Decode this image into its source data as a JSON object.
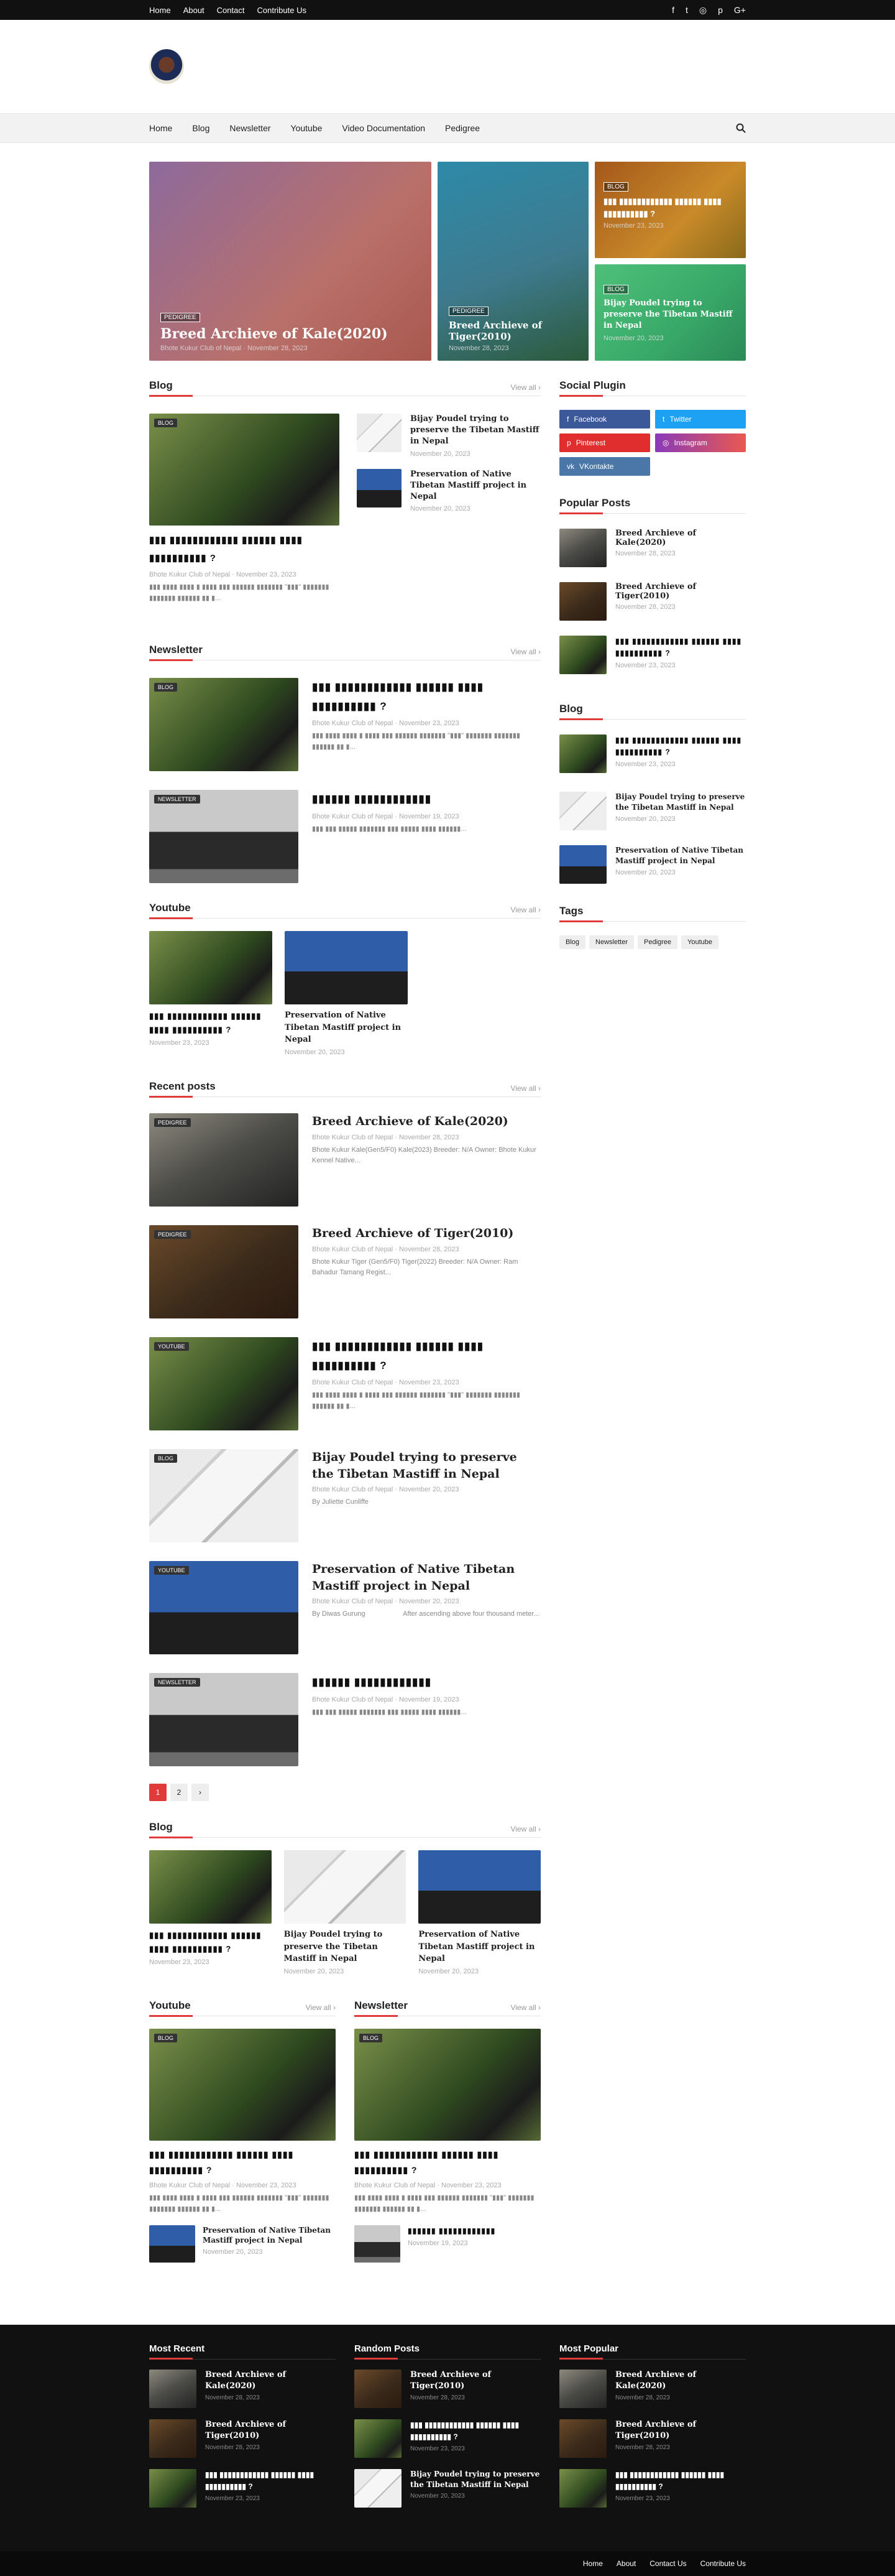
{
  "topbar": {
    "links": [
      "Home",
      "About",
      "Contact",
      "Contribute Us"
    ],
    "social": [
      "f",
      "t",
      "◎",
      "p",
      "G+"
    ]
  },
  "nav": {
    "items": [
      "Home",
      "Blog",
      "Newsletter",
      "Youtube",
      "Video Documentation",
      "Pedigree"
    ]
  },
  "featured": [
    {
      "tag": "PEDIGREE",
      "title": "Breed Archieve of Kale(2020)",
      "author": "Bhote Kukur Club of Nepal",
      "date": "November 28, 2023"
    },
    {
      "tag": "PEDIGREE",
      "title": "Breed Archieve of Tiger(2010)",
      "date": "November 28, 2023"
    },
    {
      "tag": "BLOG",
      "title": "▮▮▮ ▮▮▮▮▮▮▮▮▮▮▮▮ ▮▮▮▮▮▮ ▮▮▮▮ ▮▮▮▮▮▮▮▮▮▮ ?",
      "date": "November 23, 2023"
    },
    {
      "tag": "BLOG",
      "title": "Bijay Poudel trying to preserve the Tibetan Mastiff in Nepal",
      "date": "November 20, 2023"
    }
  ],
  "blog": {
    "title": "Blog",
    "view_all": "View all ›",
    "main": {
      "tag": "BLOG",
      "title": "▮▮▮ ▮▮▮▮▮▮▮▮▮▮▮▮ ▮▮▮▮▮▮ ▮▮▮▮ ▮▮▮▮▮▮▮▮▮▮ ?",
      "author": "Bhote Kukur Club of Nepal",
      "date": "November 23, 2023",
      "excerpt": "▮▮▮ ▮▮▮▮ ▮▮▮▮ ▮ ▮▮▮▮ ▮▮▮ ▮▮▮▮▮▮ ▮▮▮▮▮▮▮ \"▮▮▮\" ▮▮▮▮▮▮▮ ▮▮▮▮▮▮▮ ▮▮▮▮▮▮ ▮▮ ▮..."
    },
    "side": [
      {
        "title": "Bijay Poudel trying to preserve the Tibetan Mastiff in Nepal",
        "date": "November 20, 2023"
      },
      {
        "title": "Preservation of Native Tibetan Mastiff project in Nepal",
        "date": "November 20, 2023"
      }
    ]
  },
  "newsletter": {
    "title": "Newsletter",
    "view_all": "View all ›",
    "items": [
      {
        "tag": "BLOG",
        "title": "▮▮▮ ▮▮▮▮▮▮▮▮▮▮▮▮ ▮▮▮▮▮▮ ▮▮▮▮ ▮▮▮▮▮▮▮▮▮▮ ?",
        "author": "Bhote Kukur Club of Nepal",
        "date": "November 23, 2023",
        "excerpt": "▮▮▮ ▮▮▮▮ ▮▮▮▮ ▮ ▮▮▮▮ ▮▮▮ ▮▮▮▮▮▮ ▮▮▮▮▮▮▮ \"▮▮▮\" ▮▮▮▮▮▮▮ ▮▮▮▮▮▮▮ ▮▮▮▮▮▮ ▮▮ ▮..."
      },
      {
        "tag": "NEWSLETTER",
        "title": "▮▮▮▮▮▮ ▮▮▮▮▮▮▮▮▮▮▮▮",
        "author": "Bhote Kukur Club of Nepal",
        "date": "November 19, 2023",
        "excerpt": "▮▮▮ ▮▮▮ ▮▮▮▮▮ ▮▮▮▮▮▮▮ ▮▮▮ ▮▮▮▮▮ ▮▮▮▮ ▮▮▮▮▮▮..."
      }
    ]
  },
  "youtube": {
    "title": "Youtube",
    "view_all": "View all ›",
    "items": [
      {
        "title": "▮▮▮ ▮▮▮▮▮▮▮▮▮▮▮▮ ▮▮▮▮▮▮ ▮▮▮▮ ▮▮▮▮▮▮▮▮▮▮ ?",
        "date": "November 23, 2023"
      },
      {
        "title": "Preservation of Native Tibetan Mastiff project in Nepal",
        "date": "November 20, 2023"
      }
    ]
  },
  "recent": {
    "title": "Recent posts",
    "view_all": "View all ›",
    "items": [
      {
        "tag": "PEDIGREE",
        "title": "Breed Archieve of Kale(2020)",
        "author": "Bhote Kukur Club of Nepal",
        "date": "November 28, 2023",
        "excerpt": "Bhote Kukur Kale(Gen5/F0) Kale(2023) Breeder: N/A Owner: Bhote Kukur Kennel Native..."
      },
      {
        "tag": "PEDIGREE",
        "title": "Breed Archieve of Tiger(2010)",
        "author": "Bhote Kukur Club of Nepal",
        "date": "November 28, 2023",
        "excerpt": "Bhote Kukur Tiger (Gen5/F0) Tiger(2022) Breeder: N/A Owner: Ram Bahadur Tamang Regist..."
      },
      {
        "tag": "YOUTUBE",
        "title": "▮▮▮ ▮▮▮▮▮▮▮▮▮▮▮▮ ▮▮▮▮▮▮ ▮▮▮▮ ▮▮▮▮▮▮▮▮▮▮ ?",
        "author": "Bhote Kukur Club of Nepal",
        "date": "November 23, 2023",
        "excerpt": "▮▮▮ ▮▮▮▮ ▮▮▮▮ ▮ ▮▮▮▮ ▮▮▮ ▮▮▮▮▮▮ ▮▮▮▮▮▮▮ \"▮▮▮\" ▮▮▮▮▮▮▮ ▮▮▮▮▮▮▮ ▮▮▮▮▮▮ ▮▮ ▮..."
      },
      {
        "tag": "BLOG",
        "title": "Bijay Poudel trying to preserve the Tibetan Mastiff in Nepal",
        "author": "Bhote Kukur Club of Nepal",
        "date": "November 20, 2023",
        "excerpt": "By Juliette Cunliffe"
      },
      {
        "tag": "YOUTUBE",
        "title": "Preservation of Native Tibetan Mastiff project in Nepal",
        "author": "Bhote Kukur Club of Nepal",
        "date": "November 20, 2023",
        "excerpt": "By Diwas Gurung                    After ascending above four thousand meter..."
      },
      {
        "tag": "NEWSLETTER",
        "title": "▮▮▮▮▮▮ ▮▮▮▮▮▮▮▮▮▮▮▮",
        "author": "Bhote Kukur Club of Nepal",
        "date": "November 19, 2023",
        "excerpt": "▮▮▮ ▮▮▮ ▮▮▮▮▮ ▮▮▮▮▮▮▮ ▮▮▮ ▮▮▮▮▮ ▮▮▮▮ ▮▮▮▮▮▮..."
      }
    ]
  },
  "pagination": [
    "1",
    "2",
    "›"
  ],
  "blog2": {
    "title": "Blog",
    "view_all": "View all ›",
    "items": [
      {
        "title": "▮▮▮ ▮▮▮▮▮▮▮▮▮▮▮▮ ▮▮▮▮▮▮ ▮▮▮▮ ▮▮▮▮▮▮▮▮▮▮ ?",
        "date": "November 23, 2023"
      },
      {
        "title": "Bijay Poudel trying to preserve the Tibetan Mastiff in Nepal",
        "date": "November 20, 2023"
      },
      {
        "title": "Preservation of Native Tibetan Mastiff project in Nepal",
        "date": "November 20, 2023"
      }
    ]
  },
  "youtube2": {
    "title": "Youtube",
    "view_all": "View all ›",
    "main": {
      "tag": "BLOG",
      "title": "▮▮▮ ▮▮▮▮▮▮▮▮▮▮▮▮ ▮▮▮▮▮▮ ▮▮▮▮ ▮▮▮▮▮▮▮▮▮▮ ?",
      "author": "Bhote Kukur Club of Nepal",
      "date": "November 23, 2023",
      "excerpt": "▮▮▮ ▮▮▮▮ ▮▮▮▮ ▮ ▮▮▮▮ ▮▮▮ ▮▮▮▮▮▮ ▮▮▮▮▮▮▮ \"▮▮▮\" ▮▮▮▮▮▮▮ ▮▮▮▮▮▮▮ ▮▮▮▮▮▮ ▮▮ ▮..."
    },
    "small": {
      "title": "Preservation of Native Tibetan Mastiff project in Nepal",
      "date": "November 20, 2023"
    }
  },
  "newsletter2": {
    "title": "Newsletter",
    "view_all": "View all ›",
    "main": {
      "tag": "BLOG",
      "title": "▮▮▮ ▮▮▮▮▮▮▮▮▮▮▮▮ ▮▮▮▮▮▮ ▮▮▮▮ ▮▮▮▮▮▮▮▮▮▮ ?",
      "author": "Bhote Kukur Club of Nepal",
      "date": "November 23, 2023",
      "excerpt": "▮▮▮ ▮▮▮▮ ▮▮▮▮ ▮ ▮▮▮▮ ▮▮▮ ▮▮▮▮▮▮ ▮▮▮▮▮▮▮ \"▮▮▮\" ▮▮▮▮▮▮▮ ▮▮▮▮▮▮▮ ▮▮▮▮▮▮ ▮▮ ▮..."
    },
    "small": {
      "title": "▮▮▮▮▮▮ ▮▮▮▮▮▮▮▮▮▮▮▮",
      "date": "November 19, 2023"
    }
  },
  "sidebar": {
    "social_title": "Social Plugin",
    "social": [
      {
        "label": "Facebook",
        "color": "#3b5998"
      },
      {
        "label": "Twitter",
        "color": "#1da1f2"
      },
      {
        "label": "Pinterest",
        "color": "#e02e2e"
      },
      {
        "label": "Instagram",
        "color": "#c13584"
      },
      {
        "label": "VKontakte",
        "color": "#4a76a8"
      }
    ],
    "popular_title": "Popular Posts",
    "popular": [
      {
        "title": "Breed Archieve of Kale(2020)",
        "date": "November 28, 2023"
      },
      {
        "title": "Breed Archieve of Tiger(2010)",
        "date": "November 28, 2023"
      },
      {
        "title": "▮▮▮ ▮▮▮▮▮▮▮▮▮▮▮▮ ▮▮▮▮▮▮ ▮▮▮▮ ▮▮▮▮▮▮▮▮▮▮ ?",
        "date": "November 23, 2023"
      }
    ],
    "blog_title": "Blog",
    "blog": [
      {
        "title": "▮▮▮ ▮▮▮▮▮▮▮▮▮▮▮▮ ▮▮▮▮▮▮ ▮▮▮▮ ▮▮▮▮▮▮▮▮▮▮ ?",
        "date": "November 23, 2023"
      },
      {
        "title": "Bijay Poudel trying to preserve the Tibetan Mastiff in Nepal",
        "date": "November 20, 2023"
      },
      {
        "title": "Preservation of Native Tibetan Mastiff project in Nepal",
        "date": "November 20, 2023"
      }
    ],
    "tags_title": "Tags",
    "tags": [
      "Blog",
      "Newsletter",
      "Pedigree",
      "Youtube"
    ]
  },
  "footer": {
    "col1": {
      "title": "Most Recent",
      "items": [
        {
          "title": "Breed Archieve of Kale(2020)",
          "date": "November 28, 2023"
        },
        {
          "title": "Breed Archieve of Tiger(2010)",
          "date": "November 28, 2023"
        },
        {
          "title": "▮▮▮ ▮▮▮▮▮▮▮▮▮▮▮▮ ▮▮▮▮▮▮ ▮▮▮▮ ▮▮▮▮▮▮▮▮▮▮ ?",
          "date": "November 23, 2023"
        }
      ]
    },
    "col2": {
      "title": "Random Posts",
      "items": [
        {
          "title": "Breed Archieve of Tiger(2010)",
          "date": "November 28, 2023"
        },
        {
          "title": "▮▮▮ ▮▮▮▮▮▮▮▮▮▮▮▮ ▮▮▮▮▮▮ ▮▮▮▮ ▮▮▮▮▮▮▮▮▮▮ ?",
          "date": "November 23, 2023"
        },
        {
          "title": "Bijay Poudel trying to preserve the Tibetan Mastiff in Nepal",
          "date": "November 20, 2023"
        }
      ]
    },
    "col3": {
      "title": "Most Popular",
      "items": [
        {
          "title": "Breed Archieve of Kale(2020)",
          "date": "November 28, 2023"
        },
        {
          "title": "Breed Archieve of Tiger(2010)",
          "date": "November 28, 2023"
        },
        {
          "title": "▮▮▮ ▮▮▮▮▮▮▮▮▮▮▮▮ ▮▮▮▮▮▮ ▮▮▮▮ ▮▮▮▮▮▮▮▮▮▮ ?",
          "date": "November 23, 2023"
        }
      ]
    },
    "links": [
      "Home",
      "About",
      "Contact Us",
      "Contribute Us"
    ]
  }
}
